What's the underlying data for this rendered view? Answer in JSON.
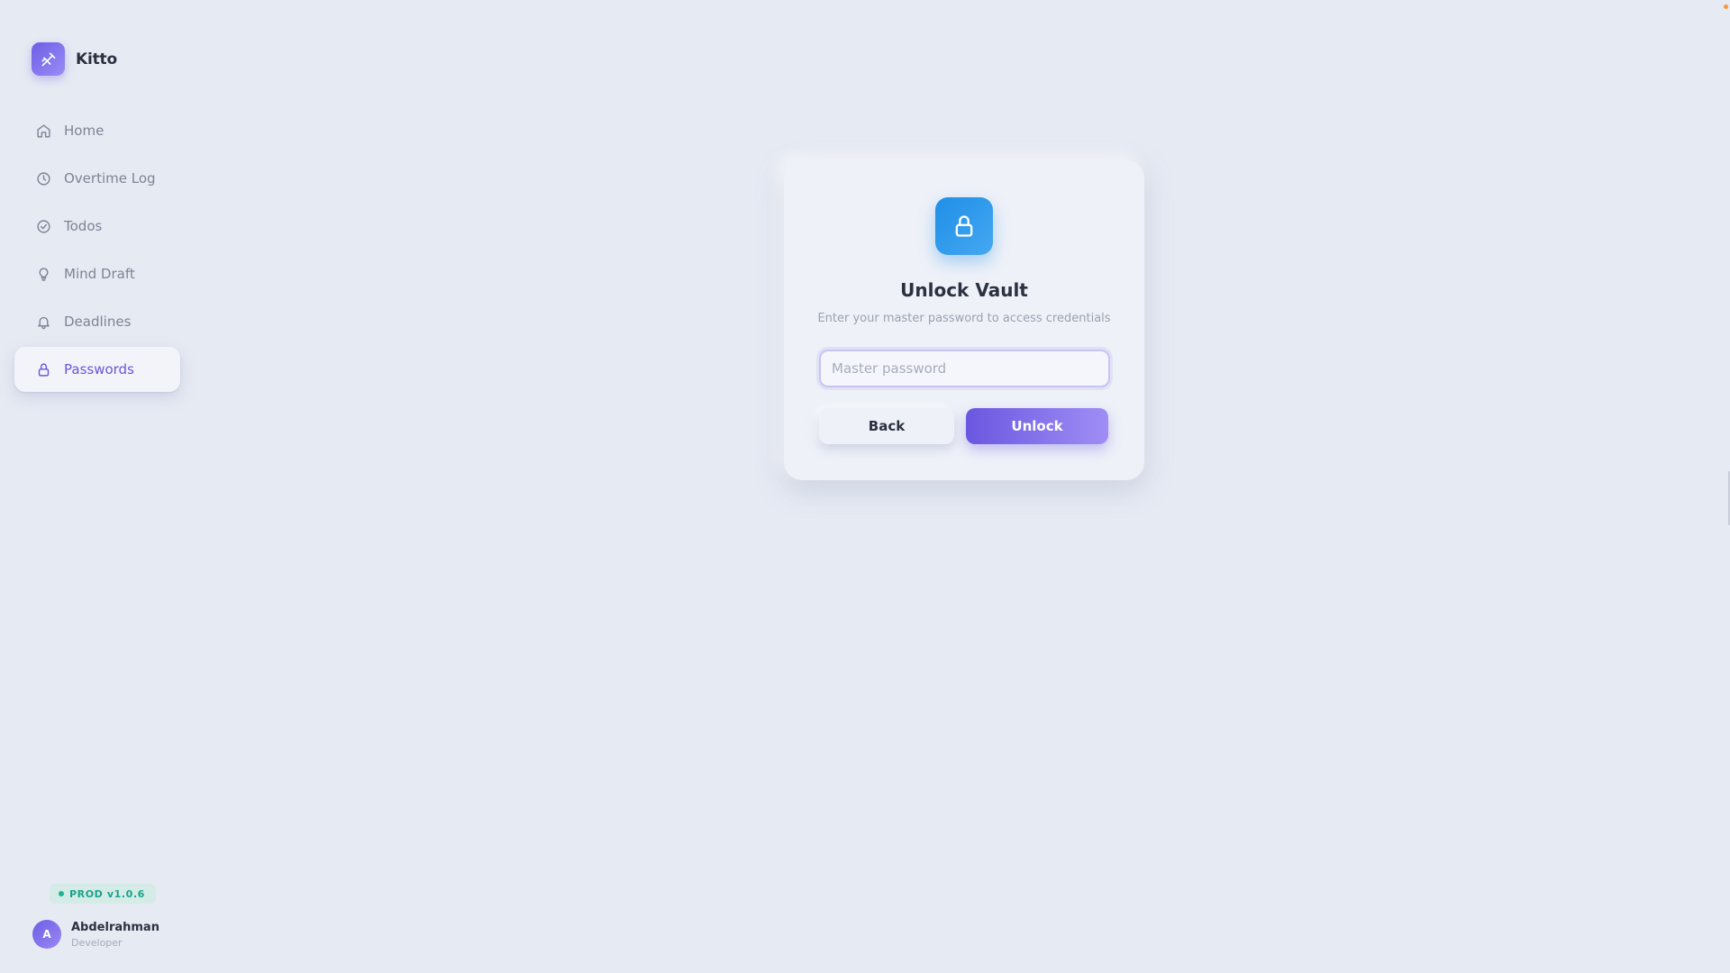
{
  "app": {
    "name": "Kitto"
  },
  "sidebar": {
    "items": [
      {
        "label": "Home",
        "icon": "home-icon",
        "active": false
      },
      {
        "label": "Overtime Log",
        "icon": "clock-icon",
        "active": false
      },
      {
        "label": "Todos",
        "icon": "check-circle-icon",
        "active": false
      },
      {
        "label": "Mind Draft",
        "icon": "lightbulb-icon",
        "active": false
      },
      {
        "label": "Deadlines",
        "icon": "bell-icon",
        "active": false
      },
      {
        "label": "Passwords",
        "icon": "lock-icon",
        "active": true
      }
    ],
    "version": "PROD v1.0.6",
    "user": {
      "initial": "A",
      "name": "Abdelrahman",
      "role": "Developer"
    }
  },
  "vault": {
    "icon": "lock-icon",
    "title": "Unlock Vault",
    "subtitle": "Enter your master password to access credentials",
    "password_value": "",
    "password_placeholder": "Master password",
    "back_label": "Back",
    "unlock_label": "Unlock"
  },
  "colors": {
    "accent": "#6b55d9",
    "lock_tile": "#1f8fe6",
    "badge_green": "#1aa389",
    "background": "#e6eaf3"
  }
}
